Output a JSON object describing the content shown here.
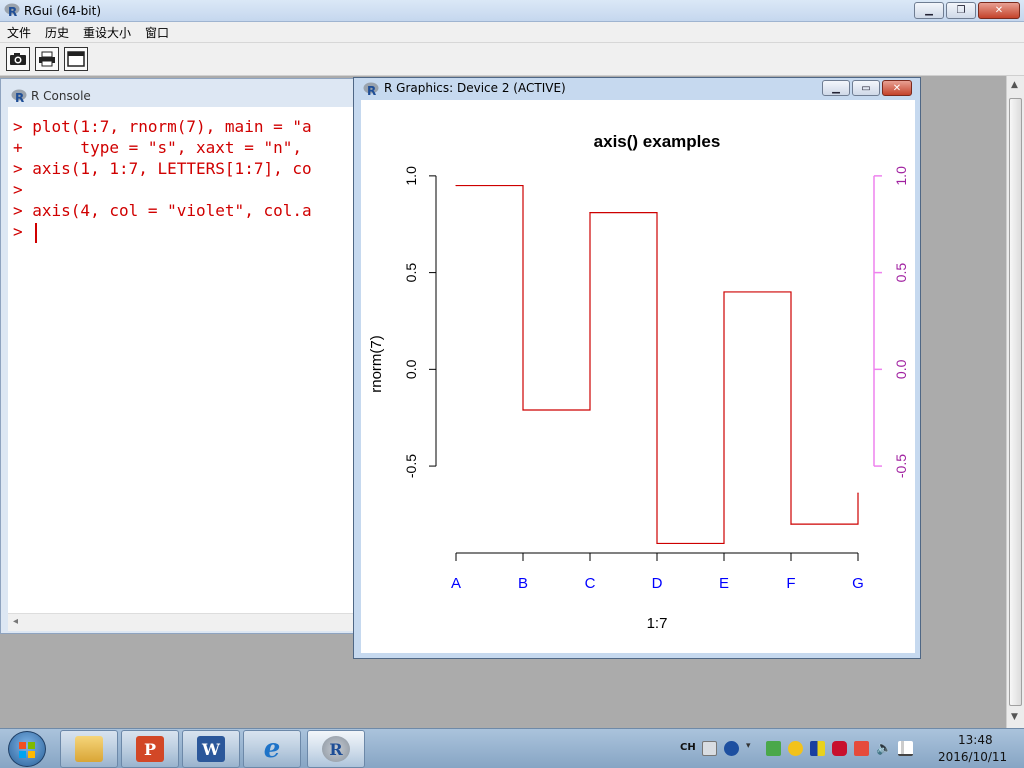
{
  "app": {
    "title": "RGui (64-bit)",
    "minimize_glyph": "▁",
    "restore_glyph": "❐",
    "close_glyph": "✕"
  },
  "menu": [
    "文件",
    "历史",
    "重设大小",
    "窗口"
  ],
  "toolbar": {
    "icons": [
      "camera-icon",
      "printer-icon",
      "console-window-icon"
    ]
  },
  "console": {
    "title": "R Console",
    "lines": [
      "> plot(1:7, rnorm(7), main = \"a",
      "+      type = \"s\", xaxt = \"n\",",
      "> axis(1, 1:7, LETTERS[1:7], co",
      ">",
      "> axis(4, col = \"violet\", col.a",
      ">"
    ],
    "text_color": "#d00000",
    "hscroll_left_glyph": "◂"
  },
  "graphics_window": {
    "title": "R Graphics: Device 2 (ACTIVE)",
    "minimize_glyph": "▁",
    "restore_glyph": "▭",
    "close_glyph": "✕"
  },
  "chart_data": {
    "type": "line",
    "title": "axis() examples",
    "xlabel": "1:7",
    "ylabel": "rnorm(7)",
    "x": [
      1,
      2,
      3,
      4,
      5,
      6,
      7
    ],
    "categories": [
      "A",
      "B",
      "C",
      "D",
      "E",
      "F",
      "G"
    ],
    "values": [
      0.95,
      -0.21,
      0.81,
      -0.9,
      0.4,
      -0.8,
      -0.64
    ],
    "step": true,
    "xlim": [
      1,
      7
    ],
    "ylim": [
      -0.97,
      1.02
    ],
    "left_axis": {
      "ticks": [
        -0.5,
        0.0,
        0.5,
        1.0
      ],
      "labels": [
        "-0.5",
        "0.0",
        "0.5",
        "1.0"
      ],
      "color": "#000000"
    },
    "right_axis": {
      "ticks": [
        -0.5,
        0.0,
        0.5,
        1.0
      ],
      "labels": [
        "-0.5",
        "0.0",
        "0.5",
        "1.0"
      ],
      "color": "#ee82ee",
      "label_color": "#a020a0"
    },
    "bottom_axis": {
      "label_color": "#0000ff"
    },
    "line_color": "#cd0000",
    "grid": false
  },
  "taskbar": {
    "apps": [
      {
        "name": "explorer",
        "letter": ""
      },
      {
        "name": "powerpoint",
        "letter": "P"
      },
      {
        "name": "word",
        "letter": "W"
      },
      {
        "name": "internet-explorer",
        "letter": "e"
      },
      {
        "name": "r-gui",
        "letter": "R"
      }
    ],
    "tray": {
      "language": "CH",
      "time": "13:48",
      "date": "2016/10/11"
    }
  }
}
